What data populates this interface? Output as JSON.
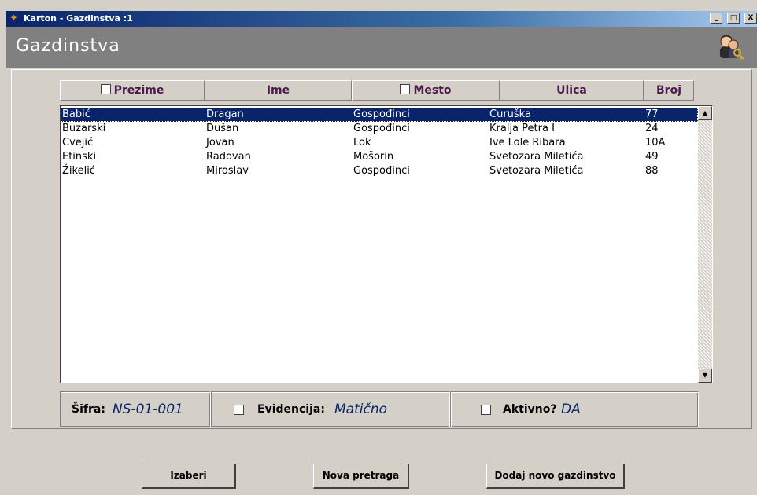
{
  "window": {
    "title": "Karton - Gazdinstva :1",
    "buttons": {
      "minimize": "_",
      "maximize": "□",
      "close": "X"
    }
  },
  "header": {
    "title": "Gazdinstva",
    "icon": "users-key-icon"
  },
  "columns": {
    "prezime": "Prezime",
    "ime": "Ime",
    "mesto": "Mesto",
    "ulica": "Ulica",
    "broj": "Broj"
  },
  "rows": [
    {
      "prezime": "Babić",
      "ime": "Dragan",
      "mesto": "Gospođinci",
      "ulica": "Čuruška",
      "broj": "77",
      "selected": true
    },
    {
      "prezime": "Buzarski",
      "ime": "Dušan",
      "mesto": "Gospođinci",
      "ulica": "Kralja Petra I",
      "broj": "24"
    },
    {
      "prezime": "Cvejić",
      "ime": "Jovan",
      "mesto": "Lok",
      "ulica": "Ive Lole Ribara",
      "broj": "10A"
    },
    {
      "prezime": "Etinski",
      "ime": "Radovan",
      "mesto": "Mošorin",
      "ulica": "Svetozara Miletića",
      "broj": "49"
    },
    {
      "prezime": "Žikelić",
      "ime": "Miroslav",
      "mesto": "Gospođinci",
      "ulica": "Svetozara Miletića",
      "broj": "88"
    }
  ],
  "info": {
    "sifra_label": "Šifra:",
    "sifra_value": "NS-01-001",
    "evidencija_label": "Evidencija:",
    "evidencija_value": "Matično",
    "aktivno_label": "Aktivno?",
    "aktivno_value": "DA"
  },
  "buttons": {
    "izaberi": "Izaberi",
    "nova_pretraga": "Nova pretraga",
    "dodaj": "Dodaj novo gazdinstvo"
  },
  "colors": {
    "title_gradient_start": "#0a246a",
    "header_bar": "#808080",
    "selection": "#0a246a",
    "column_header_text": "#4a1a4a",
    "background": "#d4d0c8"
  }
}
